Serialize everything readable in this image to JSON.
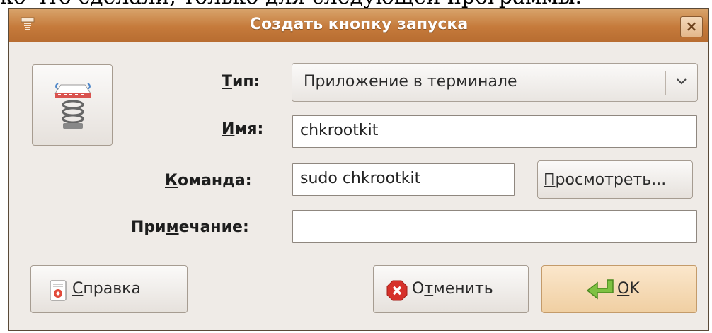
{
  "background_text": "ко что сделали, только для следующей программы.",
  "window": {
    "title": "Создать кнопку запуска",
    "close_label": "×"
  },
  "type": {
    "label_mnemonic": "Т",
    "label_rest": "ип:",
    "value": "Приложение в терминале"
  },
  "name": {
    "label_mnemonic": "И",
    "label_rest": "мя:",
    "value": "chkrootkit"
  },
  "command": {
    "label_mnemonic": "К",
    "label_rest": "оманда:",
    "value": "sudo chkrootkit",
    "browse_mnemonic": "П",
    "browse_rest": "росмотреть..."
  },
  "comment": {
    "label_pre": "При",
    "label_mnemonic": "м",
    "label_rest": "ечание:",
    "value": ""
  },
  "buttons": {
    "help_mnemonic": "С",
    "help_rest": "правка",
    "cancel_pre": "О",
    "cancel_mnemonic": "т",
    "cancel_rest": "менить",
    "ok_mnemonic": "O",
    "ok_rest": "K"
  }
}
